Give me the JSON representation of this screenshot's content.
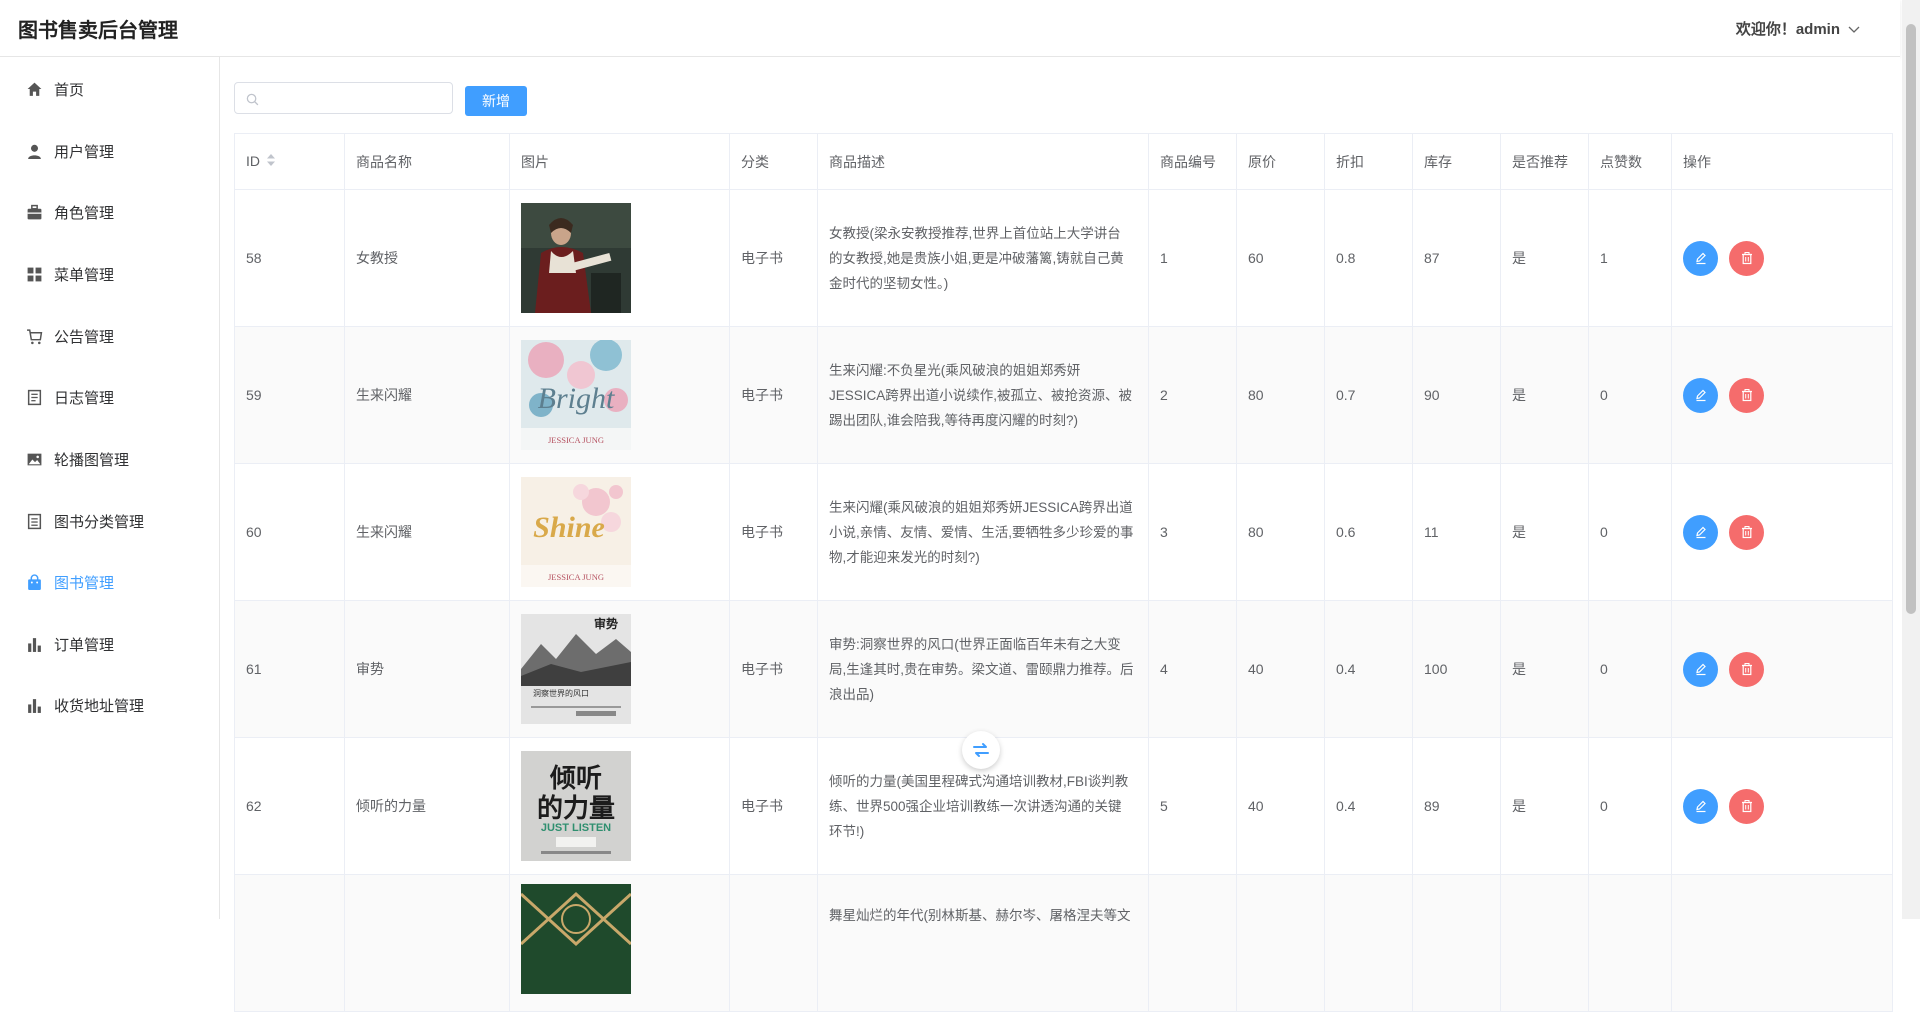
{
  "app": {
    "title": "图书售卖后台管理",
    "welcome": "欢迎你！admin"
  },
  "sidebar": {
    "items": [
      {
        "label": "首页",
        "icon": "home-icon",
        "active": false
      },
      {
        "label": "用户管理",
        "icon": "user-icon",
        "active": false
      },
      {
        "label": "角色管理",
        "icon": "briefcase-icon",
        "active": false
      },
      {
        "label": "菜单管理",
        "icon": "grid-icon",
        "active": false
      },
      {
        "label": "公告管理",
        "icon": "cart-icon",
        "active": false
      },
      {
        "label": "日志管理",
        "icon": "document-icon",
        "active": false
      },
      {
        "label": "轮播图管理",
        "icon": "picture-icon",
        "active": false
      },
      {
        "label": "图书分类管理",
        "icon": "tickets-icon",
        "active": false
      },
      {
        "label": "图书管理",
        "icon": "shopping-bag-icon",
        "active": true
      },
      {
        "label": "订单管理",
        "icon": "bar-chart-icon",
        "active": false
      },
      {
        "label": "收货地址管理",
        "icon": "bar-chart-icon",
        "active": false
      }
    ]
  },
  "toolbar": {
    "search_placeholder": "",
    "add_label": "新增"
  },
  "table": {
    "headers": {
      "id": "ID",
      "name": "商品名称",
      "image": "图片",
      "category": "分类",
      "description": "商品描述",
      "code": "商品编号",
      "price": "原价",
      "discount": "折扣",
      "stock": "库存",
      "recommend": "是否推荐",
      "likes": "点赞数",
      "actions": "操作"
    },
    "rows": [
      {
        "id": "58",
        "name": "女教授",
        "cover": "book-cover-woman-painting",
        "category": "电子书",
        "description": "女教授(梁永安教授推荐,世界上首位站上大学讲台的女教授,她是贵族小姐,更是冲破藩篱,铸就自己黄金时代的坚韧女性。)",
        "code": "1",
        "price": "60",
        "discount": "0.8",
        "stock": "87",
        "recommend": "是",
        "likes": "1"
      },
      {
        "id": "59",
        "name": "生来闪耀",
        "cover": "book-cover-bright",
        "category": "电子书",
        "description": "生来闪耀:不负星光(乘风破浪的姐姐郑秀妍JESSICA跨界出道小说续作,被孤立、被抢资源、被踢出团队,谁会陪我,等待再度闪耀的时刻?)",
        "code": "2",
        "price": "80",
        "discount": "0.7",
        "stock": "90",
        "recommend": "是",
        "likes": "0"
      },
      {
        "id": "60",
        "name": "生来闪耀",
        "cover": "book-cover-shine",
        "category": "电子书",
        "description": "生来闪耀(乘风破浪的姐姐郑秀妍JESSICA跨界出道小说,亲情、友情、爱情、生活,要牺牲多少珍爱的事物,才能迎来发光的时刻?)",
        "code": "3",
        "price": "80",
        "discount": "0.6",
        "stock": "11",
        "recommend": "是",
        "likes": "0"
      },
      {
        "id": "61",
        "name": "审势",
        "cover": "book-cover-shenshi",
        "category": "电子书",
        "description": "审势:洞察世界的风口(世界正面临百年未有之大变局,生逢其时,贵在审势。梁文道、雷颐鼎力推荐。后浪出品)",
        "code": "4",
        "price": "40",
        "discount": "0.4",
        "stock": "100",
        "recommend": "是",
        "likes": "0"
      },
      {
        "id": "62",
        "name": "倾听的力量",
        "cover": "book-cover-just-listen",
        "category": "电子书",
        "description": "倾听的力量(美国里程碑式沟通培训教材,FBI谈判教练、世界500强企业培训教练一次讲透沟通的关键环节!)",
        "code": "5",
        "price": "40",
        "discount": "0.4",
        "stock": "89",
        "recommend": "是",
        "likes": "0"
      },
      {
        "id": "",
        "name": "",
        "cover": "book-cover-green",
        "category": "",
        "description": "舞星灿烂的年代(别林斯基、赫尔岑、屠格涅夫等文",
        "code": "",
        "price": "",
        "discount": "",
        "stock": "",
        "recommend": "",
        "likes": ""
      }
    ]
  },
  "covers": {
    "bright_title": "Bright",
    "shine_title": "Shine",
    "author": "JESSICA JUNG",
    "shenshi_title": "审势",
    "shenshi_sub": "洞察世界的风口",
    "listen_cn": "倾听\n的力量",
    "listen_en": "JUST LISTEN"
  }
}
